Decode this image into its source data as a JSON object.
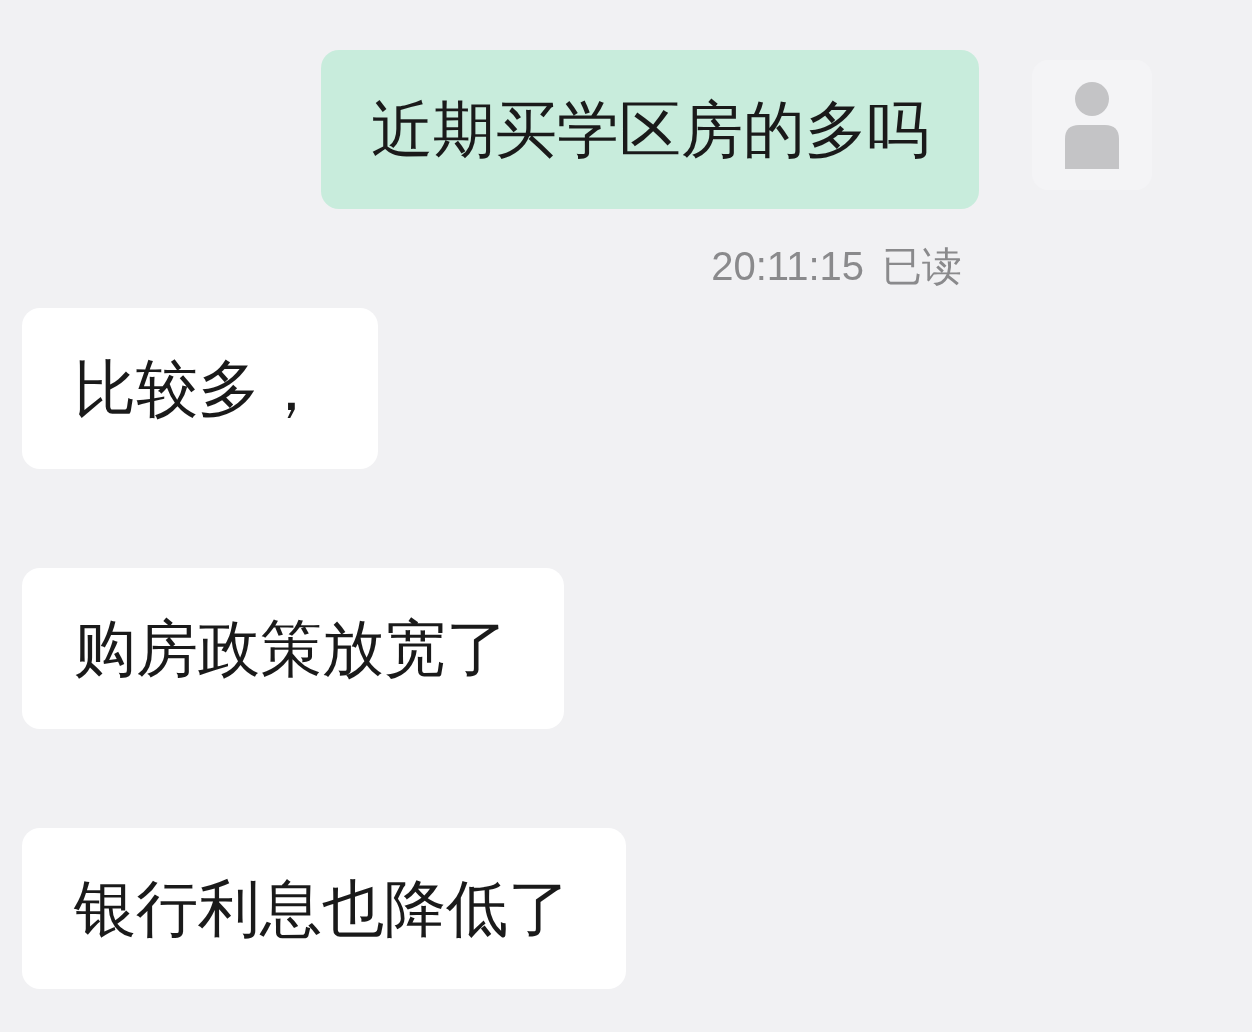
{
  "messages": [
    {
      "kind": "sent",
      "text": "近期买学区房的多吗",
      "time": "20:11:15",
      "receipt": "已读"
    },
    {
      "kind": "received",
      "text": "比较多，"
    },
    {
      "kind": "received",
      "text": "购房政策放宽了"
    },
    {
      "kind": "received",
      "text": "银行利息也降低了"
    }
  ]
}
